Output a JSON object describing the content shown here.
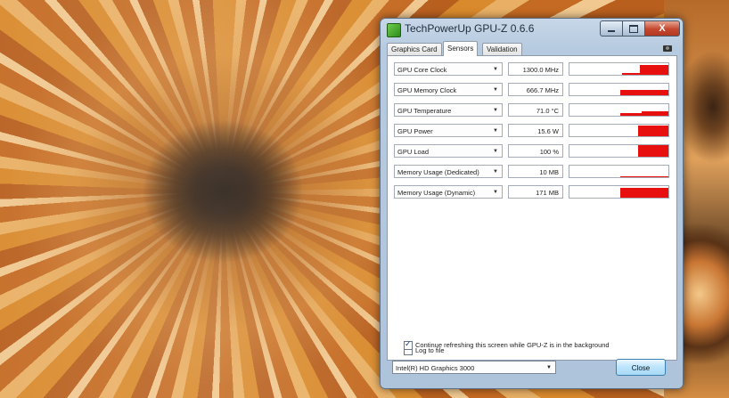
{
  "window": {
    "title": "TechPowerUp GPU-Z 0.6.6",
    "close_glyph": "X"
  },
  "tabs": [
    {
      "label": "Graphics Card"
    },
    {
      "label": "Sensors"
    },
    {
      "label": "Validation"
    }
  ],
  "sensors": [
    {
      "name": "GPU Core Clock",
      "value": "1300.0 MHz"
    },
    {
      "name": "GPU Memory Clock",
      "value": "666.7 MHz"
    },
    {
      "name": "GPU Temperature",
      "value": "71.0 °C"
    },
    {
      "name": "GPU Power",
      "value": "15.6 W"
    },
    {
      "name": "GPU Load",
      "value": "100 %"
    },
    {
      "name": "Memory Usage (Dedicated)",
      "value": "10 MB"
    },
    {
      "name": "Memory Usage (Dynamic)",
      "value": "171 MB"
    }
  ],
  "options": {
    "log_to_file": {
      "label": "Log to file",
      "checked": false
    },
    "continue_refresh": {
      "label": "Continue refreshing this screen while GPU-Z is in the background",
      "checked": true
    }
  },
  "footer": {
    "gpu_selected": "Intel(R) HD Graphics 3000",
    "close_label": "Close"
  },
  "colors": {
    "graph": "#e80f0f",
    "window_frame": "#b7cbe0"
  },
  "icons": {
    "app": "gpu-z-icon",
    "screenshot": "camera-icon",
    "dropdown": "chevron-down-icon"
  }
}
